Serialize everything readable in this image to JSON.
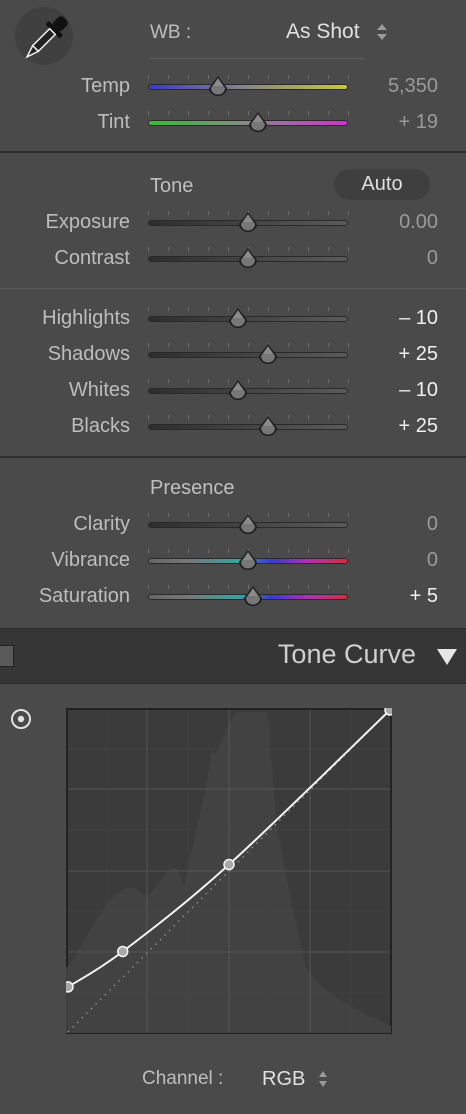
{
  "wb": {
    "label": "WB :",
    "value": "As Shot"
  },
  "sliders": [
    {
      "id": "temp",
      "label": "Temp",
      "value": "5,350",
      "pos": 0.35,
      "style": "dim",
      "track": "temp"
    },
    {
      "id": "tint",
      "label": "Tint",
      "value": "+ 19",
      "pos": 0.55,
      "style": "dim",
      "track": "tint"
    },
    {
      "id": "exposure",
      "label": "Exposure",
      "value": "0.00",
      "pos": 0.5,
      "style": "dim",
      "track": "gray"
    },
    {
      "id": "contrast",
      "label": "Contrast",
      "value": "0",
      "pos": 0.5,
      "style": "dim",
      "track": "gray"
    },
    {
      "id": "highlights",
      "label": "Highlights",
      "value": "– 10",
      "pos": 0.45,
      "style": "bright",
      "track": "gray"
    },
    {
      "id": "shadows",
      "label": "Shadows",
      "value": "+ 25",
      "pos": 0.6,
      "style": "bright",
      "track": "gray"
    },
    {
      "id": "whites",
      "label": "Whites",
      "value": "– 10",
      "pos": 0.45,
      "style": "bright",
      "track": "gray"
    },
    {
      "id": "blacks",
      "label": "Blacks",
      "value": "+ 25",
      "pos": 0.6,
      "style": "bright",
      "track": "gray"
    },
    {
      "id": "clarity",
      "label": "Clarity",
      "value": "0",
      "pos": 0.5,
      "style": "dim",
      "track": "gray"
    },
    {
      "id": "vibrance",
      "label": "Vibrance",
      "value": "0",
      "pos": 0.5,
      "style": "dim",
      "track": "rainbow"
    },
    {
      "id": "saturation",
      "label": "Saturation",
      "value": "+ 5",
      "pos": 0.525,
      "style": "bright",
      "track": "rainbow"
    }
  ],
  "tone": {
    "title": "Tone",
    "auto": "Auto"
  },
  "presence": {
    "title": "Presence"
  },
  "tone_curve": {
    "title": "Tone Curve",
    "channel_label": "Channel :",
    "channel_value": "RGB",
    "points": [
      [
        0,
        0.14
      ],
      [
        0.17,
        0.25
      ],
      [
        0.5,
        0.52
      ],
      [
        1,
        1
      ]
    ]
  },
  "icons": {
    "eyedropper": "eyedropper-icon",
    "wb_stepper": "up-down-arrows-icon",
    "collapse": "triangle-down-icon",
    "panel_toggle": "square-toggle-icon",
    "target_adjust": "target-icon",
    "channel_stepper": "up-down-arrows-icon"
  }
}
